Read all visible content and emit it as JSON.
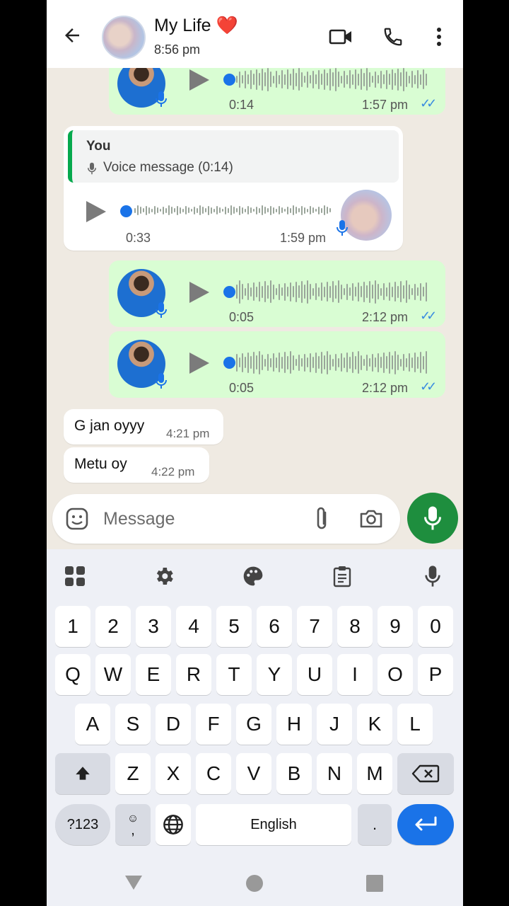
{
  "header": {
    "title": "My Life",
    "heart": "❤️",
    "subtitle": "8:56 pm"
  },
  "messages": [
    {
      "type": "voice",
      "direction": "out",
      "duration": "0:14",
      "time": "1:57 pm",
      "status": "read"
    },
    {
      "type": "voice-reply",
      "direction": "in",
      "quote_author": "You",
      "quote_text": "Voice message (0:14)",
      "duration": "0:33",
      "time": "1:59 pm"
    },
    {
      "type": "voice",
      "direction": "out",
      "duration": "0:05",
      "time": "2:12 pm",
      "status": "read"
    },
    {
      "type": "voice",
      "direction": "out",
      "duration": "0:05",
      "time": "2:12 pm",
      "status": "read"
    },
    {
      "type": "text",
      "direction": "in",
      "text": "G jan oyyy",
      "time": "4:21 pm"
    },
    {
      "type": "text",
      "direction": "in",
      "text": "Metu oy",
      "time": "4:22 pm"
    }
  ],
  "input": {
    "placeholder": "Message"
  },
  "keyboard": {
    "number_row": [
      "1",
      "2",
      "3",
      "4",
      "5",
      "6",
      "7",
      "8",
      "9",
      "0"
    ],
    "row1": [
      "Q",
      "W",
      "E",
      "R",
      "T",
      "Y",
      "U",
      "I",
      "O",
      "P"
    ],
    "row2": [
      "A",
      "S",
      "D",
      "F",
      "G",
      "H",
      "J",
      "K",
      "L"
    ],
    "row3": [
      "Z",
      "X",
      "C",
      "V",
      "B",
      "N",
      "M"
    ],
    "symbols_label": "?123",
    "comma": ",",
    "space_label": "English",
    "period": "."
  },
  "colors": {
    "accent_green": "#1e8e3e",
    "outgoing_bubble": "#d9fdd3",
    "read_ticks": "#3a8ce0",
    "enter_blue": "#1a73e8"
  }
}
